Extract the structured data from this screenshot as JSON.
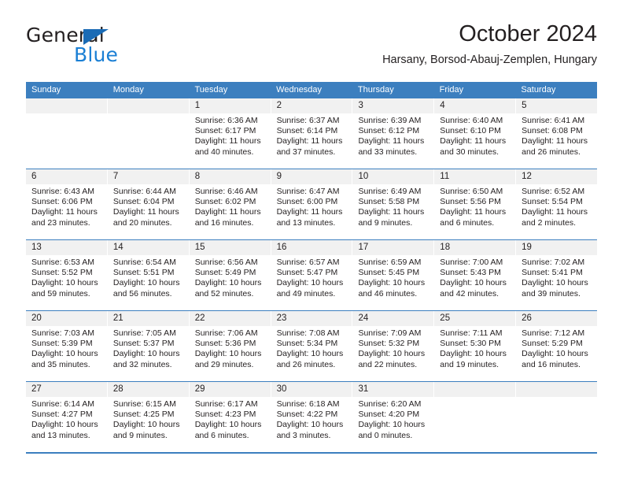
{
  "brand": {
    "name_part1": "General",
    "name_part2": "Blue",
    "triangle_color": "#1a6bb5",
    "blue_color": "#1a7fd4"
  },
  "header": {
    "title": "October 2024",
    "subtitle": "Harsany, Borsod-Abauj-Zemplen, Hungary"
  },
  "theme": {
    "header_blue": "#3c7fbf",
    "daynum_bg": "#f1f1f1",
    "text": "#231f20"
  },
  "calendar": {
    "weekday_headers": [
      "Sunday",
      "Monday",
      "Tuesday",
      "Wednesday",
      "Thursday",
      "Friday",
      "Saturday"
    ],
    "weeks": [
      [
        {
          "day": "",
          "empty": true
        },
        {
          "day": "",
          "empty": true
        },
        {
          "day": "1",
          "sunrise": "Sunrise: 6:36 AM",
          "sunset": "Sunset: 6:17 PM",
          "daylight": "Daylight: 11 hours and 40 minutes."
        },
        {
          "day": "2",
          "sunrise": "Sunrise: 6:37 AM",
          "sunset": "Sunset: 6:14 PM",
          "daylight": "Daylight: 11 hours and 37 minutes."
        },
        {
          "day": "3",
          "sunrise": "Sunrise: 6:39 AM",
          "sunset": "Sunset: 6:12 PM",
          "daylight": "Daylight: 11 hours and 33 minutes."
        },
        {
          "day": "4",
          "sunrise": "Sunrise: 6:40 AM",
          "sunset": "Sunset: 6:10 PM",
          "daylight": "Daylight: 11 hours and 30 minutes."
        },
        {
          "day": "5",
          "sunrise": "Sunrise: 6:41 AM",
          "sunset": "Sunset: 6:08 PM",
          "daylight": "Daylight: 11 hours and 26 minutes."
        }
      ],
      [
        {
          "day": "6",
          "sunrise": "Sunrise: 6:43 AM",
          "sunset": "Sunset: 6:06 PM",
          "daylight": "Daylight: 11 hours and 23 minutes."
        },
        {
          "day": "7",
          "sunrise": "Sunrise: 6:44 AM",
          "sunset": "Sunset: 6:04 PM",
          "daylight": "Daylight: 11 hours and 20 minutes."
        },
        {
          "day": "8",
          "sunrise": "Sunrise: 6:46 AM",
          "sunset": "Sunset: 6:02 PM",
          "daylight": "Daylight: 11 hours and 16 minutes."
        },
        {
          "day": "9",
          "sunrise": "Sunrise: 6:47 AM",
          "sunset": "Sunset: 6:00 PM",
          "daylight": "Daylight: 11 hours and 13 minutes."
        },
        {
          "day": "10",
          "sunrise": "Sunrise: 6:49 AM",
          "sunset": "Sunset: 5:58 PM",
          "daylight": "Daylight: 11 hours and 9 minutes."
        },
        {
          "day": "11",
          "sunrise": "Sunrise: 6:50 AM",
          "sunset": "Sunset: 5:56 PM",
          "daylight": "Daylight: 11 hours and 6 minutes."
        },
        {
          "day": "12",
          "sunrise": "Sunrise: 6:52 AM",
          "sunset": "Sunset: 5:54 PM",
          "daylight": "Daylight: 11 hours and 2 minutes."
        }
      ],
      [
        {
          "day": "13",
          "sunrise": "Sunrise: 6:53 AM",
          "sunset": "Sunset: 5:52 PM",
          "daylight": "Daylight: 10 hours and 59 minutes."
        },
        {
          "day": "14",
          "sunrise": "Sunrise: 6:54 AM",
          "sunset": "Sunset: 5:51 PM",
          "daylight": "Daylight: 10 hours and 56 minutes."
        },
        {
          "day": "15",
          "sunrise": "Sunrise: 6:56 AM",
          "sunset": "Sunset: 5:49 PM",
          "daylight": "Daylight: 10 hours and 52 minutes."
        },
        {
          "day": "16",
          "sunrise": "Sunrise: 6:57 AM",
          "sunset": "Sunset: 5:47 PM",
          "daylight": "Daylight: 10 hours and 49 minutes."
        },
        {
          "day": "17",
          "sunrise": "Sunrise: 6:59 AM",
          "sunset": "Sunset: 5:45 PM",
          "daylight": "Daylight: 10 hours and 46 minutes."
        },
        {
          "day": "18",
          "sunrise": "Sunrise: 7:00 AM",
          "sunset": "Sunset: 5:43 PM",
          "daylight": "Daylight: 10 hours and 42 minutes."
        },
        {
          "day": "19",
          "sunrise": "Sunrise: 7:02 AM",
          "sunset": "Sunset: 5:41 PM",
          "daylight": "Daylight: 10 hours and 39 minutes."
        }
      ],
      [
        {
          "day": "20",
          "sunrise": "Sunrise: 7:03 AM",
          "sunset": "Sunset: 5:39 PM",
          "daylight": "Daylight: 10 hours and 35 minutes."
        },
        {
          "day": "21",
          "sunrise": "Sunrise: 7:05 AM",
          "sunset": "Sunset: 5:37 PM",
          "daylight": "Daylight: 10 hours and 32 minutes."
        },
        {
          "day": "22",
          "sunrise": "Sunrise: 7:06 AM",
          "sunset": "Sunset: 5:36 PM",
          "daylight": "Daylight: 10 hours and 29 minutes."
        },
        {
          "day": "23",
          "sunrise": "Sunrise: 7:08 AM",
          "sunset": "Sunset: 5:34 PM",
          "daylight": "Daylight: 10 hours and 26 minutes."
        },
        {
          "day": "24",
          "sunrise": "Sunrise: 7:09 AM",
          "sunset": "Sunset: 5:32 PM",
          "daylight": "Daylight: 10 hours and 22 minutes."
        },
        {
          "day": "25",
          "sunrise": "Sunrise: 7:11 AM",
          "sunset": "Sunset: 5:30 PM",
          "daylight": "Daylight: 10 hours and 19 minutes."
        },
        {
          "day": "26",
          "sunrise": "Sunrise: 7:12 AM",
          "sunset": "Sunset: 5:29 PM",
          "daylight": "Daylight: 10 hours and 16 minutes."
        }
      ],
      [
        {
          "day": "27",
          "sunrise": "Sunrise: 6:14 AM",
          "sunset": "Sunset: 4:27 PM",
          "daylight": "Daylight: 10 hours and 13 minutes."
        },
        {
          "day": "28",
          "sunrise": "Sunrise: 6:15 AM",
          "sunset": "Sunset: 4:25 PM",
          "daylight": "Daylight: 10 hours and 9 minutes."
        },
        {
          "day": "29",
          "sunrise": "Sunrise: 6:17 AM",
          "sunset": "Sunset: 4:23 PM",
          "daylight": "Daylight: 10 hours and 6 minutes."
        },
        {
          "day": "30",
          "sunrise": "Sunrise: 6:18 AM",
          "sunset": "Sunset: 4:22 PM",
          "daylight": "Daylight: 10 hours and 3 minutes."
        },
        {
          "day": "31",
          "sunrise": "Sunrise: 6:20 AM",
          "sunset": "Sunset: 4:20 PM",
          "daylight": "Daylight: 10 hours and 0 minutes."
        },
        {
          "day": "",
          "empty": true
        },
        {
          "day": "",
          "empty": true
        }
      ]
    ]
  }
}
